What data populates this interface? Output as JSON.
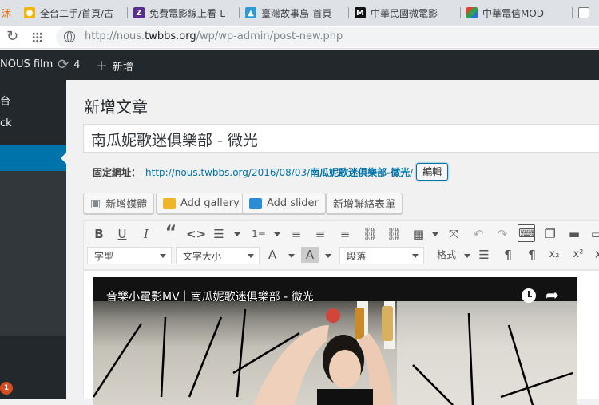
{
  "browser": {
    "tabs": [
      {
        "title": "全台二手/首頁/古",
        "icon": "pikachu-icon",
        "color": "#f2b705"
      },
      {
        "title": "免費電影線上看-L",
        "icon": "z-logo-icon",
        "color": "#5b2c8f"
      },
      {
        "title": "臺灣故事島-首頁",
        "icon": "island-icon",
        "color": "#2e9bd6"
      },
      {
        "title": "中華民國微電影",
        "icon": "m-logo-icon",
        "color": "#111111"
      },
      {
        "title": "中華電信MOD",
        "icon": "cube-icon",
        "color": "#e4412e"
      },
      {
        "title": "",
        "icon": "page-icon",
        "color": "#777777"
      }
    ],
    "url_prefix": "http://nous.",
    "url_domain": "twbbs.org",
    "url_path": "/wp/wp-admin/post-new.php"
  },
  "adminbar": {
    "site_name": "NOUS film",
    "updates_count": "4",
    "new_label": "新增"
  },
  "sidebar": {
    "items": [
      "台",
      "ck"
    ],
    "notification_count": "1"
  },
  "editor": {
    "page_title": "新增文章",
    "post_title": "南瓜妮歌迷俱樂部 - 微光",
    "permalink_label": "固定網址：",
    "permalink_base": "http://nous.twbbs.org/2016/08/03/",
    "permalink_slug": "南瓜妮歌迷俱樂部-微光",
    "permalink_tail": "/",
    "edit_button": "編輯"
  },
  "media_buttons": {
    "add_media": "新增媒體",
    "add_gallery": "Add gallery",
    "add_slider": "Add slider",
    "add_form": "新增聯絡表單"
  },
  "format_bar": {
    "font_family": "字型",
    "font_size": "文字大小",
    "text_color_label": "A",
    "bg_color_label": "A",
    "block_format": "段落",
    "styles": "格式"
  },
  "video": {
    "title": "音樂小電影MV｜南瓜妮歌迷俱樂部 - 微光"
  }
}
